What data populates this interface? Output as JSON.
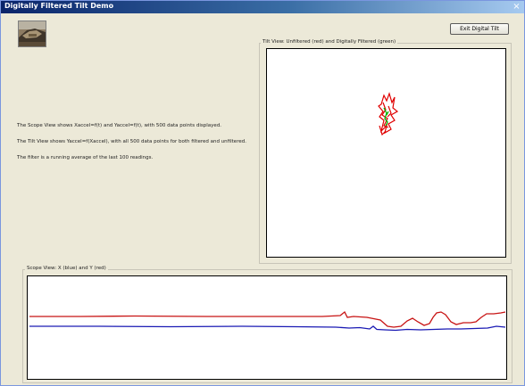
{
  "window": {
    "title": "Digitally Filtered Tilt Demo",
    "close_label": "×"
  },
  "toolbar": {
    "exit_label": "Exit Digital Tilt"
  },
  "info": {
    "line1": "The Scope View shows Xaccel=f(t) and Yaccel=f(t), with 500 data points displayed.",
    "line2": "The Tilt View shows Yaccel=f(Xaccel), with all 500 data points for both filtered and unfiltered.",
    "line3": "The filter is a running average of the last 100 readings."
  },
  "tilt_view": {
    "label": "Tilt View: Unfiltered (red) and Digitally Filtered (green)"
  },
  "scope_view": {
    "label": "Scope View: X (blue) and Y (red)"
  },
  "colors": {
    "unfiltered": "#e00000",
    "filtered": "#00b400",
    "x_trace": "#1a1ab4",
    "y_trace": "#c81414"
  },
  "icons": {
    "app": "app-photo-icon",
    "close": "close-icon"
  }
}
